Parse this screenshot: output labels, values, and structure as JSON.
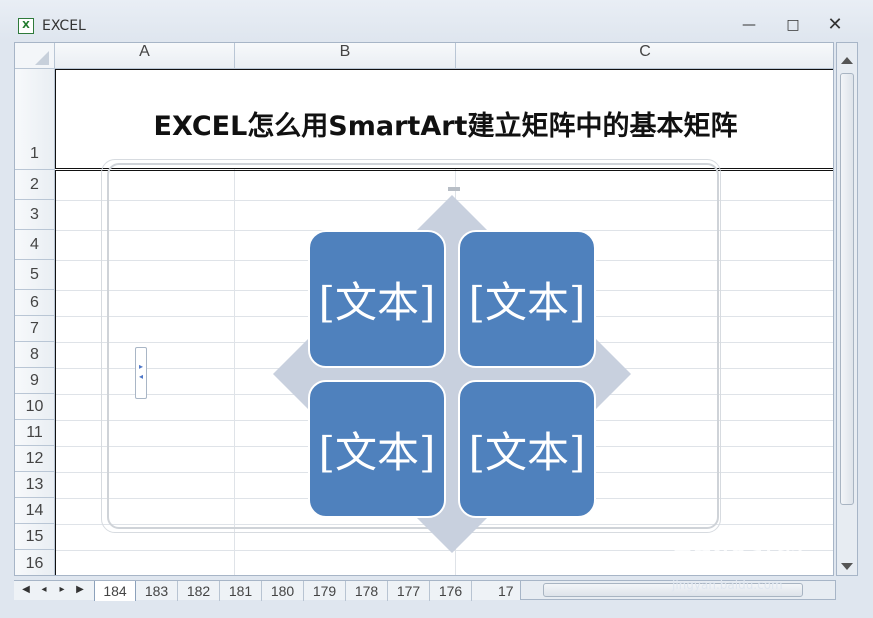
{
  "window": {
    "title": "EXCEL",
    "icon": "excel-icon",
    "controls": [
      "minimize-icon",
      "maximize-icon",
      "close-icon"
    ]
  },
  "sheet": {
    "columns": [
      "A",
      "B",
      "C"
    ],
    "rows": [
      "1",
      "2",
      "3",
      "4",
      "5",
      "6",
      "7",
      "8",
      "9",
      "10",
      "11",
      "12",
      "13",
      "14",
      "15",
      "16"
    ],
    "title_cell": "EXCEL怎么用SmartArt建立矩阵中的基本矩阵"
  },
  "smartart": {
    "texts": [
      "[文本]",
      "[文本]",
      "[文本]",
      "[文本]"
    ]
  },
  "tabs": {
    "items": [
      "184",
      "183",
      "182",
      "181",
      "180",
      "179",
      "178",
      "177",
      "176",
      "17"
    ]
  },
  "watermark": {
    "brand": "Bai度经验",
    "url": "jingyan.baidu.com"
  }
}
